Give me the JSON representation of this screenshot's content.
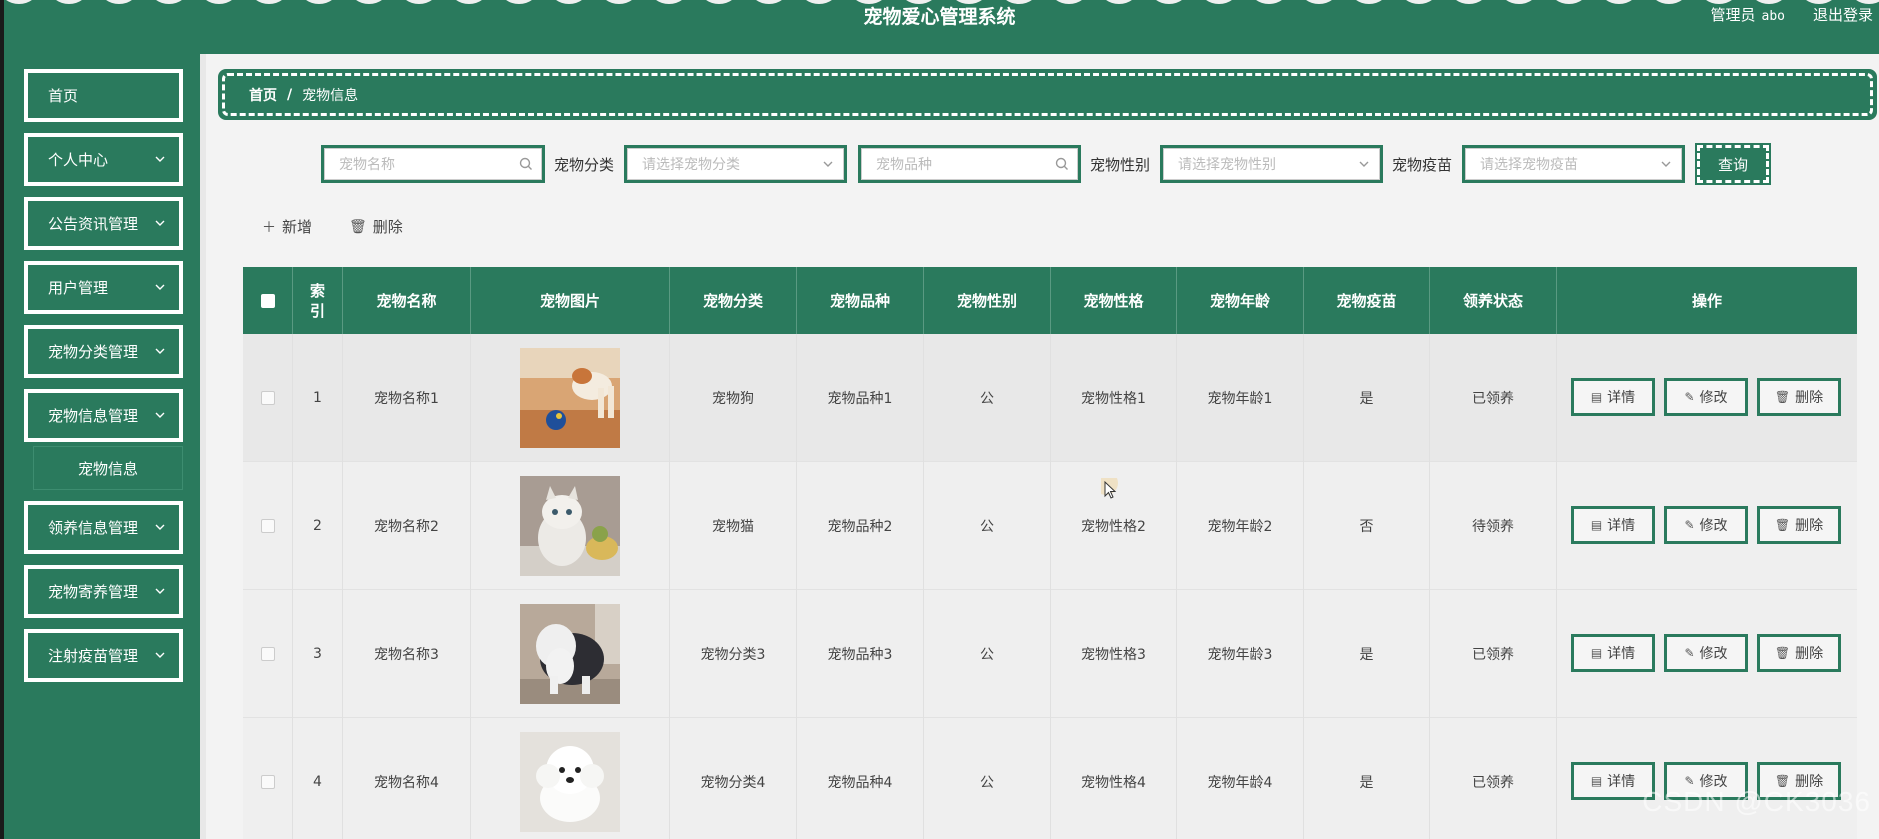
{
  "header": {
    "title": "宠物爱心管理系统",
    "role": "管理员",
    "username": "abo",
    "logout": "退出登录"
  },
  "colors": {
    "primary": "#2a7a5d",
    "white": "#ffffff"
  },
  "sidebar": {
    "items": [
      {
        "label": "首页",
        "expandable": false
      },
      {
        "label": "个人中心",
        "expandable": true
      },
      {
        "label": "公告资讯管理",
        "expandable": true
      },
      {
        "label": "用户管理",
        "expandable": true
      },
      {
        "label": "宠物分类管理",
        "expandable": true
      },
      {
        "label": "宠物信息管理",
        "expandable": true
      },
      {
        "label": "领养信息管理",
        "expandable": true
      },
      {
        "label": "宠物寄养管理",
        "expandable": true
      },
      {
        "label": "注射疫苗管理",
        "expandable": true
      }
    ],
    "sub_item": "宠物信息"
  },
  "breadcrumb": {
    "home": "首页",
    "sep": "/",
    "current": "宠物信息"
  },
  "search": {
    "name_placeholder": "宠物名称",
    "category_label": "宠物分类",
    "category_placeholder": "请选择宠物分类",
    "breed_placeholder": "宠物品种",
    "gender_label": "宠物性别",
    "gender_placeholder": "请选择宠物性别",
    "vaccine_label": "宠物疫苗",
    "vaccine_placeholder": "请选择宠物疫苗",
    "query_label": "查询"
  },
  "actions": {
    "add": "新增",
    "delete": "删除"
  },
  "table": {
    "columns": [
      "索引",
      "宠物名称",
      "宠物图片",
      "宠物分类",
      "宠物品种",
      "宠物性别",
      "宠物性格",
      "宠物年龄",
      "宠物疫苗",
      "领养状态",
      "操作"
    ],
    "rows": [
      {
        "index": "1",
        "name": "宠物名称1",
        "category": "宠物狗",
        "breed": "宠物品种1",
        "gender": "公",
        "personality": "宠物性格1",
        "age": "宠物年龄1",
        "vaccine": "是",
        "status": "已领养"
      },
      {
        "index": "2",
        "name": "宠物名称2",
        "category": "宠物猫",
        "breed": "宠物品种2",
        "gender": "公",
        "personality": "宠物性格2",
        "age": "宠物年龄2",
        "vaccine": "否",
        "status": "待领养"
      },
      {
        "index": "3",
        "name": "宠物名称3",
        "category": "宠物分类3",
        "breed": "宠物品种3",
        "gender": "公",
        "personality": "宠物性格3",
        "age": "宠物年龄3",
        "vaccine": "是",
        "status": "已领养"
      },
      {
        "index": "4",
        "name": "宠物名称4",
        "category": "宠物分类4",
        "breed": "宠物品种4",
        "gender": "公",
        "personality": "宠物性格4",
        "age": "宠物年龄4",
        "vaccine": "是",
        "status": "已领养"
      }
    ],
    "op_detail": "详情",
    "op_edit": "修改",
    "op_delete": "删除"
  },
  "watermark": "CSDN @CK3036"
}
